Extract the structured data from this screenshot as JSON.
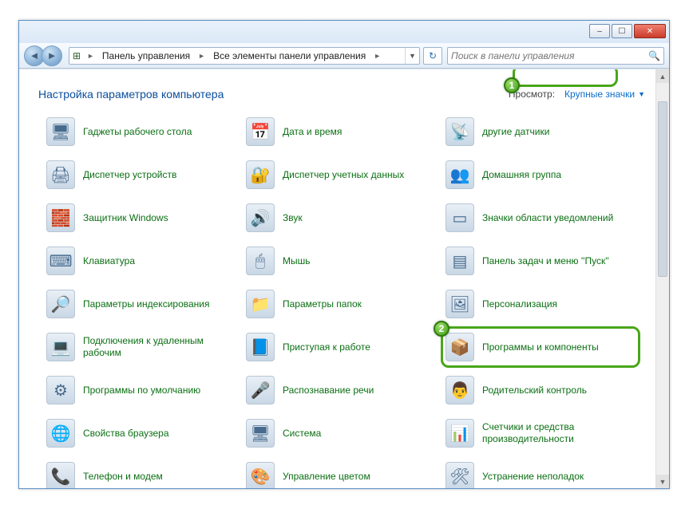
{
  "window": {
    "minimize_icon": "–",
    "maximize_icon": "☐",
    "close_icon": "✕"
  },
  "nav": {
    "back_glyph": "◄",
    "forward_glyph": "►"
  },
  "breadcrumb": {
    "icon": "⊞",
    "seg1": "Панель управления",
    "seg2": "Все элементы панели управления",
    "chev": "►",
    "drop": "▼"
  },
  "refresh_glyph": "↻",
  "search": {
    "placeholder": "Поиск в панели управления",
    "icon": "🔍"
  },
  "header": {
    "title": "Настройка параметров компьютера",
    "view_label": "Просмотр:",
    "view_value": "Крупные значки",
    "view_tri": "▼"
  },
  "annotations": {
    "badge1": "1",
    "badge2": "2"
  },
  "items": [
    [
      "Гаджеты рабочего стола",
      "🖥"
    ],
    [
      "Дата и время",
      "📅"
    ],
    [
      "другие датчики",
      "📡"
    ],
    [
      "Диспетчер устройств",
      "🖨"
    ],
    [
      "Диспетчер учетных данных",
      "🔐"
    ],
    [
      "Домашняя группа",
      "👥"
    ],
    [
      "Защитник Windows",
      "🧱"
    ],
    [
      "Звук",
      "🔊"
    ],
    [
      "Значки области уведомлений",
      "▭"
    ],
    [
      "Клавиатура",
      "⌨"
    ],
    [
      "Мышь",
      "🖱"
    ],
    [
      "Панель задач и меню ''Пуск''",
      "▤"
    ],
    [
      "Параметры индексирования",
      "🔎"
    ],
    [
      "Параметры папок",
      "📁"
    ],
    [
      "Персонализация",
      "🖼"
    ],
    [
      "Подключения к удаленным рабочим",
      "💻"
    ],
    [
      "Приступая к работе",
      "📘"
    ],
    [
      "Программы и компоненты",
      "📦"
    ],
    [
      "Программы по умолчанию",
      "⚙"
    ],
    [
      "Распознавание речи",
      "🎤"
    ],
    [
      "Родительский контроль",
      "👨"
    ],
    [
      "Свойства браузера",
      "🌐"
    ],
    [
      "Система",
      "🖥"
    ],
    [
      "Счетчики и средства производительности",
      "📊"
    ],
    [
      "Телефон и модем",
      "📞"
    ],
    [
      "Управление цветом",
      "🎨"
    ],
    [
      "Устранение неполадок",
      "🛠"
    ]
  ]
}
